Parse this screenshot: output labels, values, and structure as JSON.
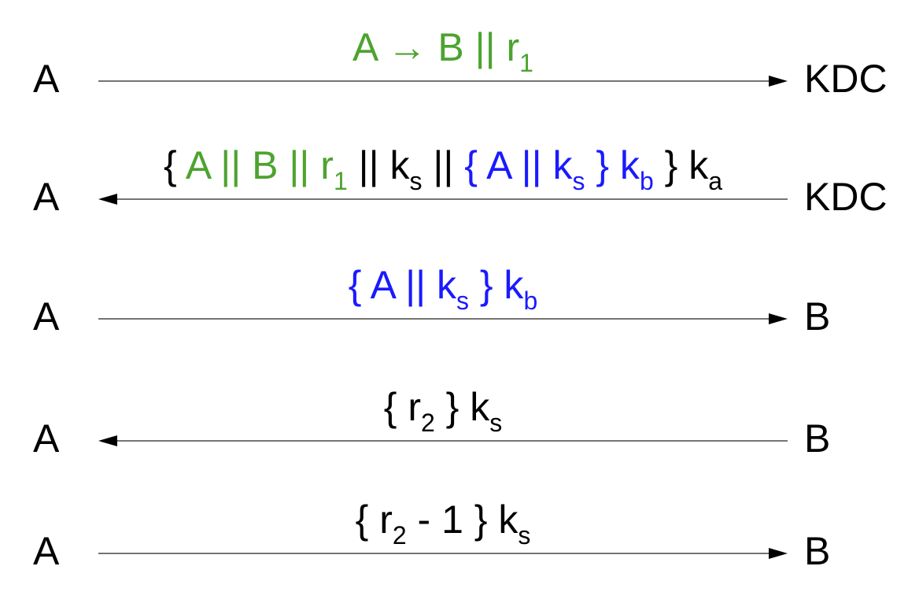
{
  "colors": {
    "green": "#4da32f",
    "blue": "#1a1aff",
    "black": "#000000"
  },
  "rows": [
    {
      "left": "A",
      "right": "KDC",
      "direction": "right",
      "segments": [
        {
          "text": "A → B || r",
          "sub": "1",
          "color": "green"
        }
      ]
    },
    {
      "left": "A",
      "right": "KDC",
      "direction": "left",
      "segments": [
        {
          "text": "{ ",
          "color": "black"
        },
        {
          "text": "A || B || r",
          "sub": "1",
          "color": "green"
        },
        {
          "text": " || k",
          "sub": "s",
          "color": "black"
        },
        {
          "text": " || ",
          "color": "black"
        },
        {
          "text": "{ A || k",
          "sub": "s",
          "color": "blue"
        },
        {
          "text": " } k",
          "sub": "b",
          "color": "blue"
        },
        {
          "text": " } k",
          "sub": "a",
          "color": "black"
        }
      ]
    },
    {
      "left": "A",
      "right": "B",
      "direction": "right",
      "segments": [
        {
          "text": "{ A || k",
          "sub": "s",
          "color": "blue"
        },
        {
          "text": " } k",
          "sub": "b",
          "color": "blue"
        }
      ]
    },
    {
      "left": "A",
      "right": "B",
      "direction": "left",
      "segments": [
        {
          "text": "{ r",
          "sub": "2",
          "color": "black"
        },
        {
          "text": " } k",
          "sub": "s",
          "color": "black"
        }
      ]
    },
    {
      "left": "A",
      "right": "B",
      "direction": "right",
      "segments": [
        {
          "text": "{ r",
          "sub": "2",
          "color": "black"
        },
        {
          "text": " - 1 } k",
          "sub": "s",
          "color": "black"
        }
      ]
    }
  ]
}
